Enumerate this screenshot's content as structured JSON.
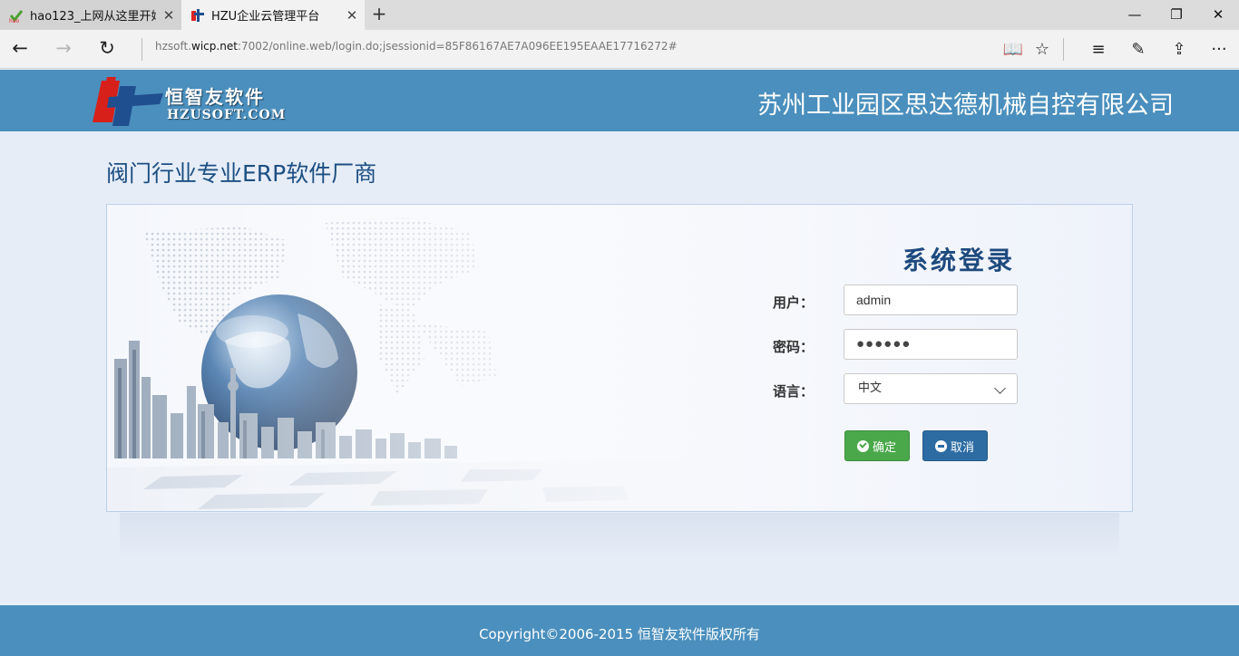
{
  "browser": {
    "tabs": [
      {
        "title": "hao123_上网从这里开始",
        "favicon": "hao123-icon",
        "active": false
      },
      {
        "title": "HZU企业云管理平台",
        "favicon": "hzu-icon",
        "active": true
      }
    ],
    "address": {
      "prefix": "hzsoft.",
      "domain": "wicp.net",
      "rest": ":7002/online.web/login.do;jsessionid=85F86167AE7A096EE195EAAE17716272#"
    }
  },
  "header": {
    "logo_cn": "恒智友软件",
    "logo_en": "HZUSOFT.COM",
    "company": "苏州工业园区思达德机械自控有限公司"
  },
  "slogan": "阀门行业专业ERP软件厂商",
  "login": {
    "title": "系统登录",
    "user_label": "用户：",
    "user_value": "admin",
    "password_label": "密码：",
    "password_value": "●●●●●●",
    "language_label": "语言：",
    "language_value": "中文",
    "ok_label": "确定",
    "cancel_label": "取消"
  },
  "footer": {
    "copyright": "Copyright©2006-2015 恒智友软件版权所有"
  },
  "colors": {
    "header_bg": "#4a8fbd",
    "page_bg": "#e6edf7",
    "ok_button": "#4aa84a",
    "cancel_button": "#2d6ca3",
    "slogan": "#1d4f82"
  }
}
